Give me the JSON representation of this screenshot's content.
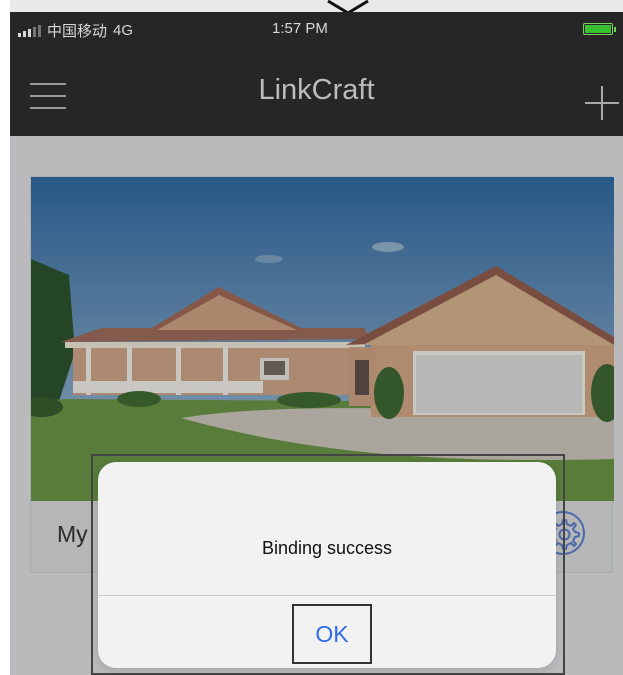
{
  "status_bar": {
    "carrier": "中国移动",
    "network": "4G",
    "time": "1:57 PM",
    "signal_icon": "signal-bars-icon",
    "battery_icon": "battery-charging-icon"
  },
  "nav": {
    "title": "LinkCraft",
    "menu_icon": "hamburger-menu-icon",
    "add_icon": "plus-icon"
  },
  "device_card": {
    "name": "My",
    "image": "house-photo",
    "settings_icon": "gear-icon"
  },
  "dialog": {
    "message": "Binding success",
    "ok_label": "OK"
  },
  "colors": {
    "header_background": "#262626",
    "ok_text": "#2e6fe8",
    "battery_green": "#37c12f"
  }
}
